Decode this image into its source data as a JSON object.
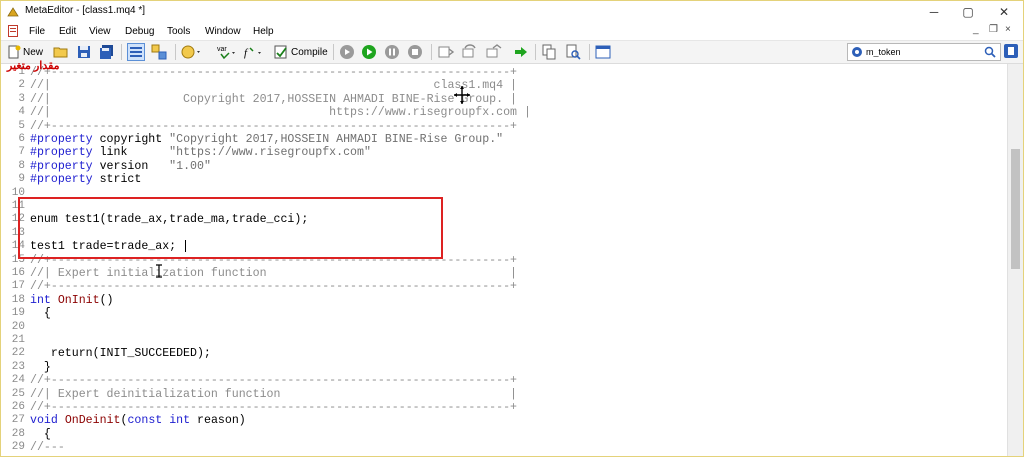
{
  "window": {
    "title": "MetaEditor - [class1.mq4 *]",
    "controls": [
      "─",
      "▢",
      "✕"
    ]
  },
  "menu": [
    "File",
    "Edit",
    "View",
    "Debug",
    "Tools",
    "Window",
    "Help"
  ],
  "mdi_controls": [
    "_",
    "❐",
    "×"
  ],
  "toolbar": {
    "new_label": "New",
    "compile_label": "Compile",
    "var_label": "var",
    "f_label": "f"
  },
  "search": {
    "value": "m_token"
  },
  "overlay": {
    "text": "مقدار متغیر"
  },
  "colors": {
    "highlight": "#dd2222",
    "keyword": "#2020d0",
    "comment": "#8c8c8c"
  },
  "code": [
    {
      "n": "1",
      "t": "//+------------------------------------------------------------------+",
      "c": "c-comment"
    },
    {
      "n": "2",
      "t": "//|                                                       class1.mq4 |",
      "c": "c-comment"
    },
    {
      "n": "3",
      "t": "//|                   Copyright 2017,HOSSEIN AHMADI BINE-Rise Group. |",
      "c": "c-comment"
    },
    {
      "n": "4",
      "t": "//|                                        https://www.risegroupfx.com |",
      "c": "c-comment"
    },
    {
      "n": "5",
      "t": "//+------------------------------------------------------------------+",
      "c": "c-comment"
    },
    {
      "n": "6",
      "t": "#property copyright \"Copyright 2017,HOSSEIN AHMADI BINE-Rise Group.\"",
      "c": "c-prop"
    },
    {
      "n": "7",
      "t": "#property link      \"https://www.risegroupfx.com\"",
      "c": "c-prop"
    },
    {
      "n": "8",
      "t": "#property version   \"1.00\"",
      "c": "c-prop"
    },
    {
      "n": "9",
      "t": "#property strict",
      "c": "c-prop"
    },
    {
      "n": "10",
      "t": "",
      "c": ""
    },
    {
      "n": "11",
      "t": "",
      "c": ""
    },
    {
      "n": "12",
      "t": "enum test1(trade_ax,trade_ma,trade_cci);",
      "c": ""
    },
    {
      "n": "13",
      "t": "",
      "c": ""
    },
    {
      "n": "14",
      "t": "test1 trade=trade_ax;",
      "c": ""
    },
    {
      "n": "15",
      "t": "//+------------------------------------------------------------------+",
      "c": "c-comment"
    },
    {
      "n": "16",
      "t": "//| Expert initialization function                                   |",
      "c": "c-comment"
    },
    {
      "n": "17",
      "t": "//+------------------------------------------------------------------+",
      "c": "c-comment"
    },
    {
      "n": "18",
      "t": "int OnInit()",
      "c": "c-fndecl"
    },
    {
      "n": "19",
      "t": "  {",
      "c": ""
    },
    {
      "n": "20",
      "t": "",
      "c": ""
    },
    {
      "n": "21",
      "t": "",
      "c": ""
    },
    {
      "n": "22",
      "t": "   return(INIT_SUCCEEDED);",
      "c": ""
    },
    {
      "n": "23",
      "t": "  }",
      "c": ""
    },
    {
      "n": "24",
      "t": "//+------------------------------------------------------------------+",
      "c": "c-comment"
    },
    {
      "n": "25",
      "t": "//| Expert deinitialization function                                 |",
      "c": "c-comment"
    },
    {
      "n": "26",
      "t": "//+------------------------------------------------------------------+",
      "c": "c-comment"
    },
    {
      "n": "27",
      "t": "void OnDeinit(const int reason)",
      "c": "c-fndecl"
    },
    {
      "n": "28",
      "t": "  {",
      "c": ""
    },
    {
      "n": "29",
      "t": "//---",
      "c": "c-comment"
    }
  ]
}
